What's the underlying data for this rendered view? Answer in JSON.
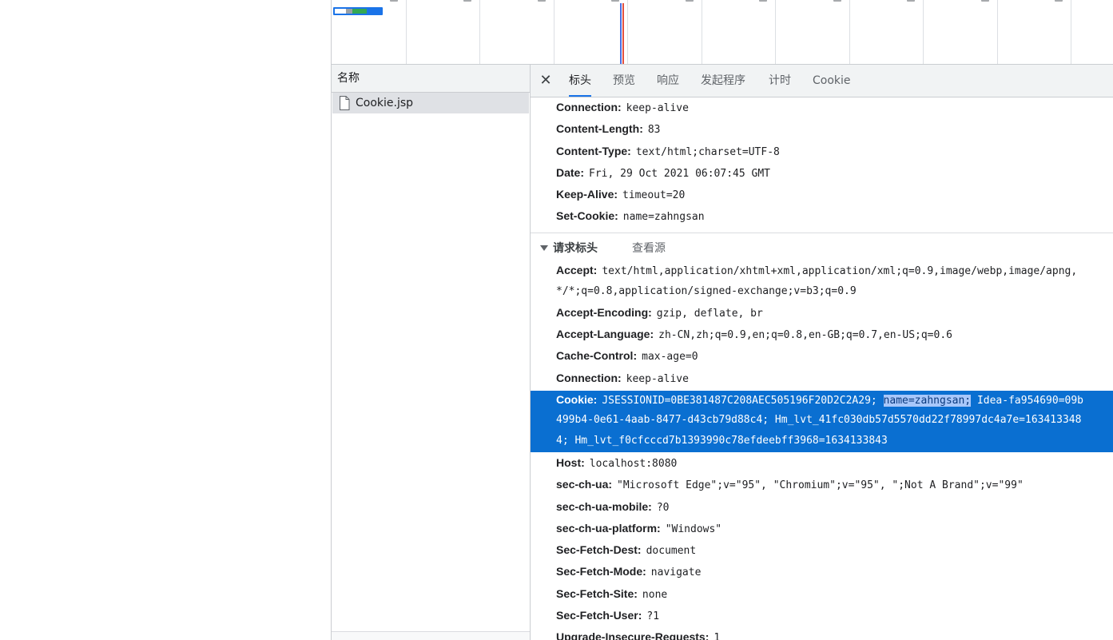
{
  "colors": {
    "accent": "#1a73e8",
    "selection": "#0a6fd1",
    "text_highlight": "#a8c7fa"
  },
  "name_panel": {
    "header": "名称",
    "files": [
      {
        "name": "Cookie.jsp",
        "icon": "document-icon"
      }
    ]
  },
  "tabs": [
    {
      "label": "标头",
      "active": true
    },
    {
      "label": "预览",
      "active": false
    },
    {
      "label": "响应",
      "active": false
    },
    {
      "label": "发起程序",
      "active": false
    },
    {
      "label": "计时",
      "active": false
    },
    {
      "label": "Cookie",
      "active": false
    }
  ],
  "response_headers": [
    {
      "key": "Connection:",
      "value": "keep-alive"
    },
    {
      "key": "Content-Length:",
      "value": "83"
    },
    {
      "key": "Content-Type:",
      "value": "text/html;charset=UTF-8"
    },
    {
      "key": "Date:",
      "value": "Fri, 29 Oct 2021 06:07:45 GMT"
    },
    {
      "key": "Keep-Alive:",
      "value": "timeout=20"
    },
    {
      "key": "Set-Cookie:",
      "value": "name=zahngsan"
    }
  ],
  "request_section": {
    "title": "请求标头",
    "view_source": "查看源"
  },
  "request_headers_top": [
    {
      "key": "Accept:",
      "value": "text/html,application/xhtml+xml,application/xml;q=0.9,image/webp,image/apng,",
      "value2": "*/*;q=0.8,application/signed-exchange;v=b3;q=0.9"
    },
    {
      "key": "Accept-Encoding:",
      "value": "gzip, deflate, br"
    },
    {
      "key": "Accept-Language:",
      "value": "zh-CN,zh;q=0.9,en;q=0.8,en-GB;q=0.7,en-US;q=0.6"
    },
    {
      "key": "Cache-Control:",
      "value": "max-age=0"
    },
    {
      "key": "Connection:",
      "value": "keep-alive"
    }
  ],
  "cookie_header": {
    "key": "Cookie:",
    "line1_before": "JSESSIONID=0BE381487C208AEC505196F20D2C2A29; ",
    "line1_selected": "name=zahngsan;",
    "line1_after": " Idea-fa954690=09b",
    "line2": "499b4-0e61-4aab-8477-d43cb79d88c4; Hm_lvt_41fc030db57d5570dd22f78997dc4a7e=163413348",
    "line3": "4; Hm_lvt_f0cfcccd7b1393990c78efdeebff3968=1634133843"
  },
  "request_headers_bottom": [
    {
      "key": "Host:",
      "value": "localhost:8080"
    },
    {
      "key": "sec-ch-ua:",
      "value": "\"Microsoft Edge\";v=\"95\", \"Chromium\";v=\"95\", \";Not A Brand\";v=\"99\""
    },
    {
      "key": "sec-ch-ua-mobile:",
      "value": "?0"
    },
    {
      "key": "sec-ch-ua-platform:",
      "value": "\"Windows\""
    },
    {
      "key": "Sec-Fetch-Dest:",
      "value": "document"
    },
    {
      "key": "Sec-Fetch-Mode:",
      "value": "navigate"
    },
    {
      "key": "Sec-Fetch-Site:",
      "value": "none"
    },
    {
      "key": "Sec-Fetch-User:",
      "value": "?1"
    },
    {
      "key": "Upgrade-Insecure-Requests:",
      "value": "1"
    }
  ]
}
